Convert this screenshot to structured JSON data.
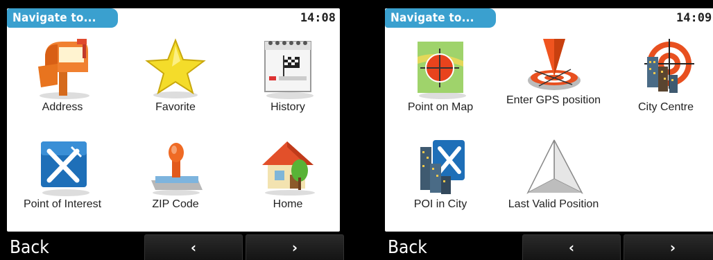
{
  "left": {
    "title": "Navigate to...",
    "time": "14:08",
    "items": [
      {
        "label": "Address"
      },
      {
        "label": "Favorite"
      },
      {
        "label": "History"
      },
      {
        "label": "Point of Interest"
      },
      {
        "label": "ZIP Code"
      },
      {
        "label": "Home"
      }
    ],
    "back_label": "Back",
    "prev_label": "‹",
    "next_label": "›"
  },
  "right": {
    "title": "Navigate to...",
    "time": "14:09",
    "items": [
      {
        "label": "Point on Map"
      },
      {
        "label": "Enter GPS position"
      },
      {
        "label": "City Centre"
      },
      {
        "label": "POI in City"
      },
      {
        "label": "Last Valid Position"
      }
    ],
    "back_label": "Back",
    "prev_label": "‹",
    "next_label": "›"
  },
  "colors": {
    "title_tab": "#3aa0cf",
    "panel": "#ffffff",
    "background": "#000000"
  }
}
